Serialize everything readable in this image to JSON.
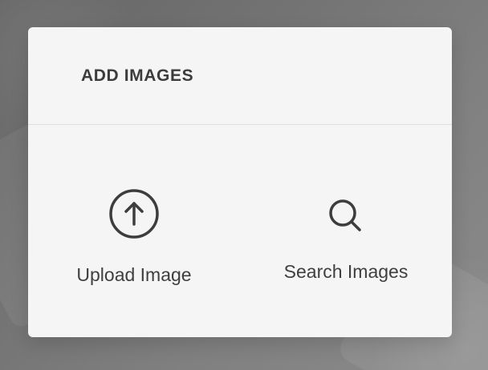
{
  "dialog": {
    "title": "ADD IMAGES",
    "options": [
      {
        "label": "Upload Image",
        "icon": "upload-icon"
      },
      {
        "label": "Search Images",
        "icon": "search-icon"
      }
    ]
  },
  "colors": {
    "background": "#7c7c7c",
    "modal_background": "#f5f5f5",
    "text": "#3f3f3f",
    "divider": "#dddddd"
  }
}
